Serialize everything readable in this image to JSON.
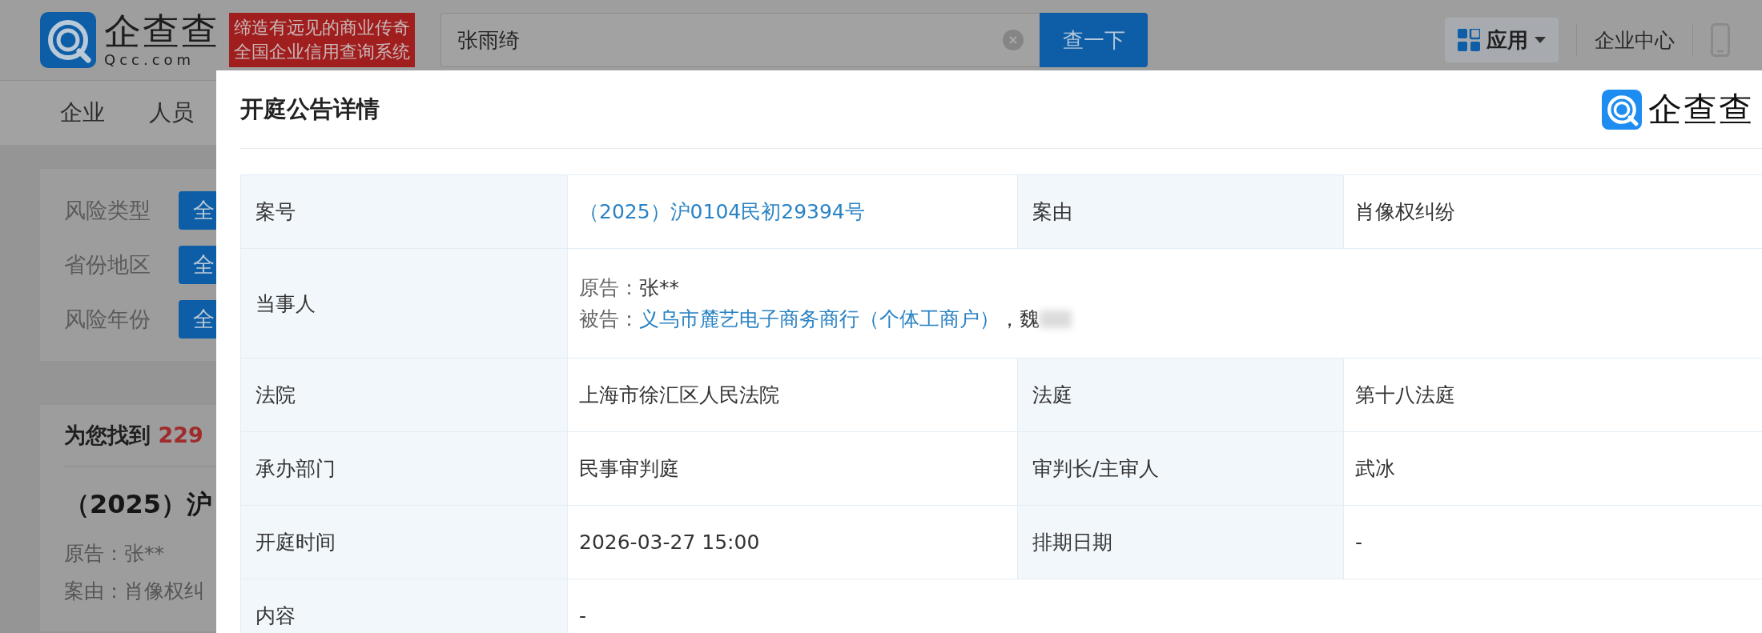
{
  "header": {
    "logo_name": "企查查",
    "logo_domain": "Qcc.com",
    "slogan": [
      "缔造有远见的商业传奇",
      "全国企业信用查询系统"
    ],
    "search": {
      "value": "张雨绮"
    },
    "search_button": "查一下",
    "apps_menu": "应用",
    "enterprise_center": "企业中心"
  },
  "nav": [
    "企业",
    "人员"
  ],
  "filters": [
    {
      "label": "风险类型",
      "option": "全"
    },
    {
      "label": "省份地区",
      "option": "全"
    },
    {
      "label": "风险年份",
      "option": "全"
    }
  ],
  "results": {
    "prefix": "为您找到",
    "count": "229",
    "case_title": "（2025）沪",
    "plaintiff": "原告：张**",
    "cause": "案由：肖像权纠"
  },
  "modal": {
    "title": "开庭公告详情",
    "brand": "企查查",
    "rows": [
      [
        {
          "kind": "label",
          "text": "案号"
        },
        {
          "kind": "link",
          "text": "（2025）沪0104民初29394号"
        },
        {
          "kind": "label",
          "text": "案由"
        },
        {
          "kind": "text",
          "text": "肖像权纠纷"
        }
      ],
      [
        {
          "kind": "label",
          "text": "当事人"
        },
        {
          "kind": "parties",
          "lines": [
            [
              {
                "kind": "prefix",
                "text": "原告："
              },
              {
                "kind": "text",
                "text": "张**"
              }
            ],
            [
              {
                "kind": "prefix",
                "text": "被告："
              },
              {
                "kind": "link",
                "text": "义乌市麓艺电子商务商行（个体工商户）"
              },
              {
                "kind": "text",
                "text": "，魏"
              },
              {
                "kind": "blur"
              }
            ]
          ]
        }
      ],
      [
        {
          "kind": "label",
          "text": "法院"
        },
        {
          "kind": "text",
          "text": "上海市徐汇区人民法院"
        },
        {
          "kind": "label",
          "text": "法庭"
        },
        {
          "kind": "text",
          "text": "第十八法庭"
        }
      ],
      [
        {
          "kind": "label",
          "text": "承办部门"
        },
        {
          "kind": "text",
          "text": "民事审判庭"
        },
        {
          "kind": "label",
          "text": "审判长/主审人"
        },
        {
          "kind": "text",
          "text": "武冰"
        }
      ],
      [
        {
          "kind": "label",
          "text": "开庭时间"
        },
        {
          "kind": "text",
          "text": "2026-03-27 15:00"
        },
        {
          "kind": "label",
          "text": "排期日期"
        },
        {
          "kind": "text",
          "text": "-"
        }
      ],
      [
        {
          "kind": "label",
          "text": "内容"
        },
        {
          "kind": "text",
          "text": "-"
        }
      ]
    ]
  }
}
